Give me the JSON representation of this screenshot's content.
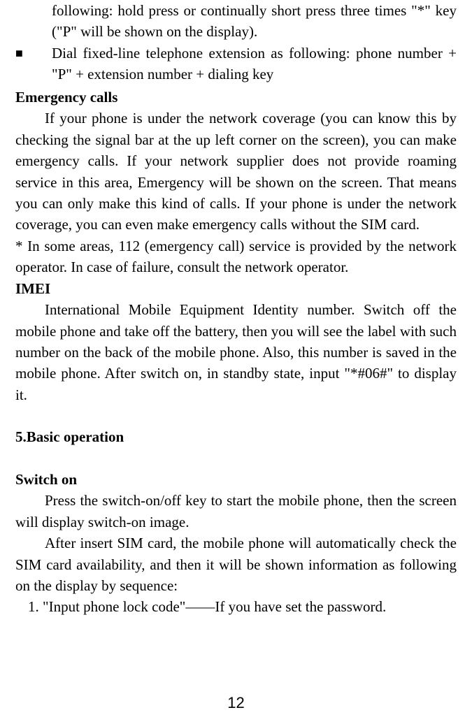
{
  "bullets": {
    "b1_cont": "following: hold press or continually short press three times \"*\" key (\"P\" will be shown on the display).",
    "b2": "Dial fixed-line telephone extension as following: phone number + \"P\" + extension number + dialing key"
  },
  "emergency": {
    "heading": "Emergency calls",
    "p1": "If your phone is under the network coverage (you can know this by checking the signal bar at the up left corner on the screen), you can make emergency calls. If your network supplier does not provide roaming service in this area, Emergency will be shown on the screen. That means you can only make this kind of calls. If your phone is under the network coverage, you can even make emergency calls without the SIM card.",
    "note": "* In some areas, 112 (emergency call) service is provided by the network operator. In case of failure, consult the network operator."
  },
  "imei": {
    "heading": "IMEI",
    "p1": "International Mobile Equipment Identity number. Switch off the mobile phone and take off the battery, then you will see the label with such number on the back of the mobile phone. Also, this number is saved in the mobile phone. After switch on, in standby state, input \"*#06#\" to display it."
  },
  "basic_op": {
    "heading": "5.Basic operation"
  },
  "switch_on": {
    "heading": "Switch on",
    "p1": "Press the switch-on/off key to start the mobile phone, then the screen will display switch-on image.",
    "p2": "After insert SIM card, the mobile phone will automatically check the SIM card availability, and then it will be shown information as following on the display by sequence:",
    "item1": "1. \"Input phone lock code\"——If you have set the password."
  },
  "page_number": "12"
}
